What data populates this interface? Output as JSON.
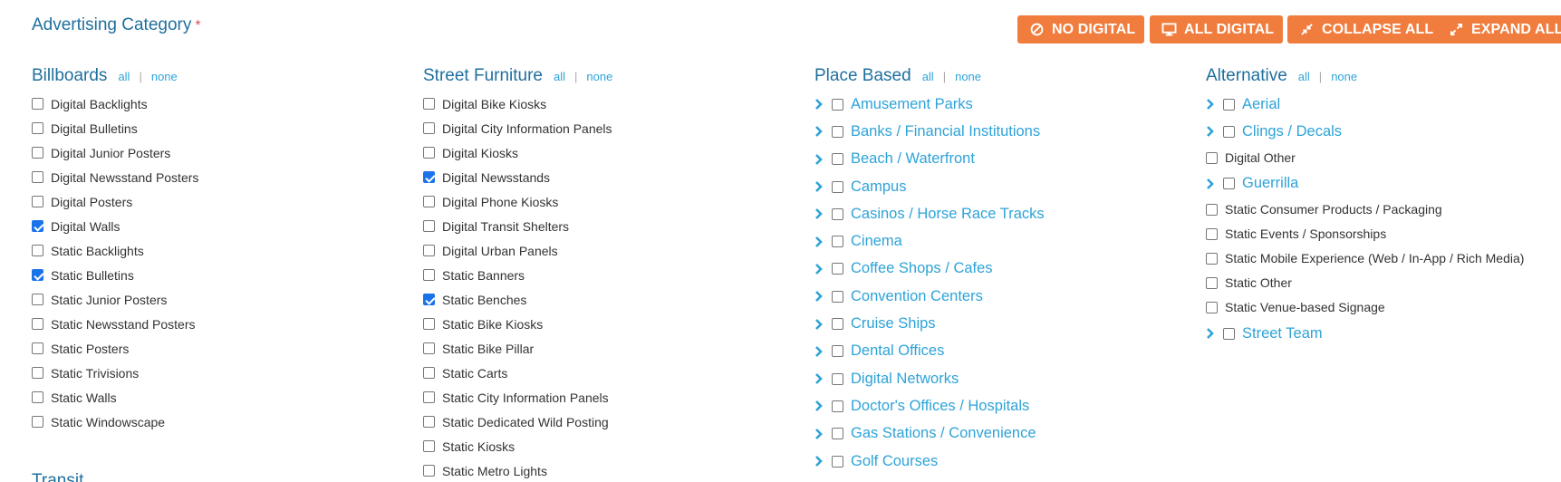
{
  "header": {
    "title": "Advertising Category",
    "required_mark": "*"
  },
  "buttons": {
    "no_digital": "NO DIGITAL",
    "all_digital": "ALL DIGITAL",
    "collapse_all": "COLLAPSE ALL",
    "expand_all": "EXPAND ALL"
  },
  "colors": {
    "accent": "#f07c3d",
    "heading": "#1f6f9e",
    "link": "#2ea3d8",
    "checked": "#1a73e8"
  },
  "link_all": "all",
  "link_none": "none",
  "columns": {
    "billboards": {
      "title": "Billboards",
      "items": [
        {
          "label": "Digital Backlights",
          "checked": false
        },
        {
          "label": "Digital Bulletins",
          "checked": false
        },
        {
          "label": "Digital Junior Posters",
          "checked": false
        },
        {
          "label": "Digital Newsstand Posters",
          "checked": false
        },
        {
          "label": "Digital Posters",
          "checked": false
        },
        {
          "label": "Digital Walls",
          "checked": true
        },
        {
          "label": "Static Backlights",
          "checked": false
        },
        {
          "label": "Static Bulletins",
          "checked": true
        },
        {
          "label": "Static Junior Posters",
          "checked": false
        },
        {
          "label": "Static Newsstand Posters",
          "checked": false
        },
        {
          "label": "Static Posters",
          "checked": false
        },
        {
          "label": "Static Trivisions",
          "checked": false
        },
        {
          "label": "Static Walls",
          "checked": false
        },
        {
          "label": "Static Windowscape",
          "checked": false
        }
      ]
    },
    "street_furniture": {
      "title": "Street Furniture",
      "items": [
        {
          "label": "Digital Bike Kiosks",
          "checked": false
        },
        {
          "label": "Digital City Information Panels",
          "checked": false
        },
        {
          "label": "Digital Kiosks",
          "checked": false
        },
        {
          "label": "Digital Newsstands",
          "checked": true
        },
        {
          "label": "Digital Phone Kiosks",
          "checked": false
        },
        {
          "label": "Digital Transit Shelters",
          "checked": false
        },
        {
          "label": "Digital Urban Panels",
          "checked": false
        },
        {
          "label": "Static Banners",
          "checked": false
        },
        {
          "label": "Static Benches",
          "checked": true
        },
        {
          "label": "Static Bike Kiosks",
          "checked": false
        },
        {
          "label": "Static Bike Pillar",
          "checked": false
        },
        {
          "label": "Static Carts",
          "checked": false
        },
        {
          "label": "Static City Information Panels",
          "checked": false
        },
        {
          "label": "Static Dedicated Wild Posting",
          "checked": false
        },
        {
          "label": "Static Kiosks",
          "checked": false
        },
        {
          "label": "Static Metro Lights",
          "checked": false
        }
      ]
    },
    "place_based": {
      "title": "Place Based",
      "items": [
        {
          "label": "Amusement Parks",
          "checked": false
        },
        {
          "label": "Banks / Financial Institutions",
          "checked": false
        },
        {
          "label": "Beach / Waterfront",
          "checked": false
        },
        {
          "label": "Campus",
          "checked": false
        },
        {
          "label": "Casinos / Horse Race Tracks",
          "checked": false
        },
        {
          "label": "Cinema",
          "checked": false
        },
        {
          "label": "Coffee Shops / Cafes",
          "checked": false
        },
        {
          "label": "Convention Centers",
          "checked": false
        },
        {
          "label": "Cruise Ships",
          "checked": false
        },
        {
          "label": "Dental Offices",
          "checked": false
        },
        {
          "label": "Digital Networks",
          "checked": false
        },
        {
          "label": "Doctor's Offices / Hospitals",
          "checked": false
        },
        {
          "label": "Gas Stations / Convenience",
          "checked": false
        },
        {
          "label": "Golf Courses",
          "checked": false
        }
      ]
    },
    "alternative": {
      "title": "Alternative",
      "items": [
        {
          "label": "Aerial",
          "expandable": true,
          "checked": false
        },
        {
          "label": "Clings / Decals",
          "expandable": true,
          "checked": false
        },
        {
          "label": "Digital Other",
          "expandable": false,
          "checked": false
        },
        {
          "label": "Guerrilla",
          "expandable": true,
          "checked": false
        },
        {
          "label": "Static Consumer Products / Packaging",
          "expandable": false,
          "checked": false
        },
        {
          "label": "Static Events / Sponsorships",
          "expandable": false,
          "checked": false
        },
        {
          "label": "Static Mobile Experience (Web / In-App / Rich Media)",
          "expandable": false,
          "checked": false
        },
        {
          "label": "Static Other",
          "expandable": false,
          "checked": false
        },
        {
          "label": "Static Venue-based Signage",
          "expandable": false,
          "checked": false
        },
        {
          "label": "Street Team",
          "expandable": true,
          "checked": false
        }
      ]
    },
    "transit": {
      "title": "Transit"
    }
  }
}
